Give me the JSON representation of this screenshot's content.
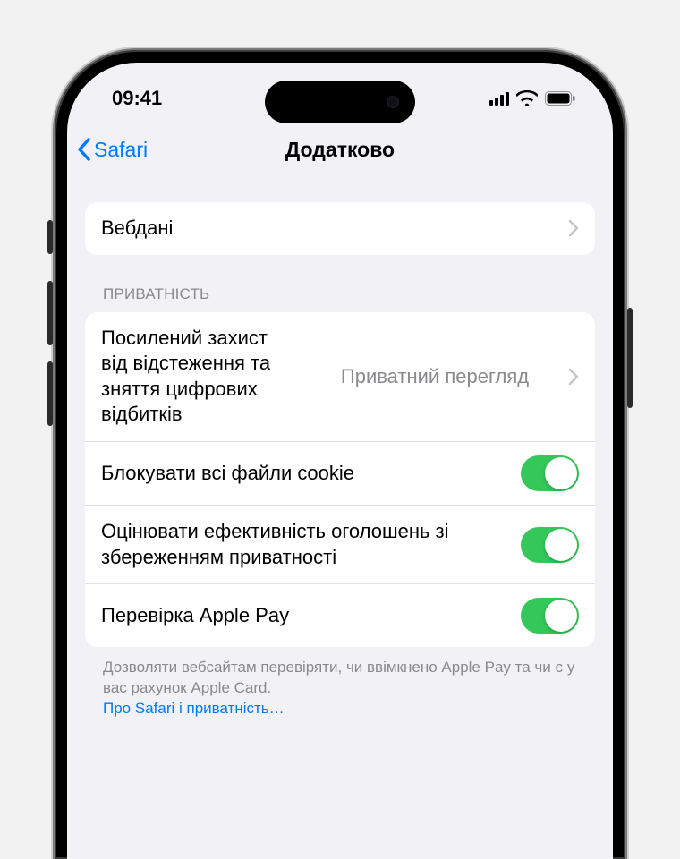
{
  "status": {
    "time": "09:41"
  },
  "nav": {
    "back": "Safari",
    "title": "Додатково"
  },
  "group1": {
    "webdata": "Вебдані"
  },
  "privacy": {
    "header": "ПРИВАТНІСТЬ",
    "tracking": {
      "label": "Посилений захист від відстеження та зняття цифрових відбитків",
      "value": "Приватний перегляд"
    },
    "cookies": {
      "label": "Блокувати всі файли cookie",
      "on": true
    },
    "ads": {
      "label": "Оцінювати ефективність оголошень зі збереженням приватності",
      "on": true
    },
    "applepay": {
      "label": "Перевірка Apple Pay",
      "on": true
    },
    "footer": "Дозволяти вебсайтам перевіряти, чи ввімкнено Apple Pay та чи є у вас рахунок Apple Card.",
    "footer_link": "Про Safari і приватність…"
  }
}
